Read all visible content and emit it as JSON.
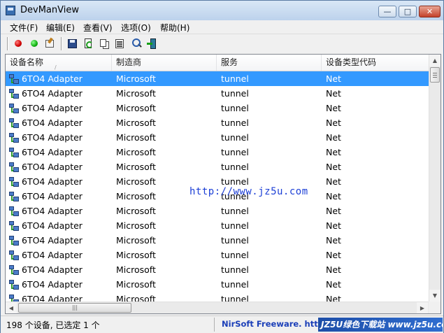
{
  "window": {
    "title": "DevManView"
  },
  "window_controls": {
    "minimize": "—",
    "maximize": "□",
    "close": "✕"
  },
  "menu": [
    "文件(F)",
    "编辑(E)",
    "查看(V)",
    "选项(O)",
    "帮助(H)"
  ],
  "toolbar": {
    "icons": [
      "disable-device-icon",
      "enable-device-icon",
      "properties-icon",
      "save-icon",
      "refresh-icon",
      "copy-icon",
      "html-report-icon",
      "find-icon",
      "exit-icon"
    ]
  },
  "columns": [
    "设备名称",
    "制造商",
    "服务",
    "设备类型代码"
  ],
  "sort_indicator": "/",
  "rows": [
    [
      "6TO4 Adapter",
      "Microsoft",
      "tunnel",
      "Net"
    ],
    [
      "6TO4 Adapter",
      "Microsoft",
      "tunnel",
      "Net"
    ],
    [
      "6TO4 Adapter",
      "Microsoft",
      "tunnel",
      "Net"
    ],
    [
      "6TO4 Adapter",
      "Microsoft",
      "tunnel",
      "Net"
    ],
    [
      "6TO4 Adapter",
      "Microsoft",
      "tunnel",
      "Net"
    ],
    [
      "6TO4 Adapter",
      "Microsoft",
      "tunnel",
      "Net"
    ],
    [
      "6TO4 Adapter",
      "Microsoft",
      "tunnel",
      "Net"
    ],
    [
      "6TO4 Adapter",
      "Microsoft",
      "tunnel",
      "Net"
    ],
    [
      "6TO4 Adapter",
      "Microsoft",
      "tunnel",
      "Net"
    ],
    [
      "6TO4 Adapter",
      "Microsoft",
      "tunnel",
      "Net"
    ],
    [
      "6TO4 Adapter",
      "Microsoft",
      "tunnel",
      "Net"
    ],
    [
      "6TO4 Adapter",
      "Microsoft",
      "tunnel",
      "Net"
    ],
    [
      "6TO4 Adapter",
      "Microsoft",
      "tunnel",
      "Net"
    ],
    [
      "6TO4 Adapter",
      "Microsoft",
      "tunnel",
      "Net"
    ],
    [
      "6TO4 Adapter",
      "Microsoft",
      "tunnel",
      "Net"
    ],
    [
      "6TO4 Adapter",
      "Microsoft",
      "tunnel",
      "Net"
    ]
  ],
  "selected_row": 0,
  "watermark": "http://www.jz5u.com",
  "status": {
    "count": "198 个设备, 已选定 1 个",
    "credit": "NirSoft Freeware.  http://w",
    "logo": "JZ5U绿色下载站 www.jz5u.com"
  },
  "colors": {
    "selection": "#3399ff",
    "link": "#1b3fb8"
  }
}
